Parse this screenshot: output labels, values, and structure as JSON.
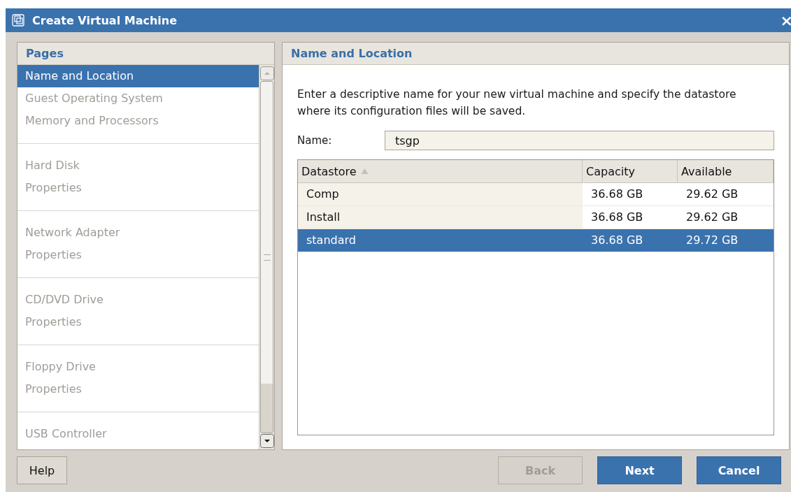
{
  "window": {
    "title": "Create Virtual Machine",
    "close": "×"
  },
  "sidebar": {
    "title": "Pages",
    "groups": [
      [
        {
          "label": "Name and Location",
          "selected": true,
          "disabled": false
        },
        {
          "label": "Guest Operating System",
          "selected": false,
          "disabled": true
        },
        {
          "label": "Memory and Processors",
          "selected": false,
          "disabled": true
        }
      ],
      [
        {
          "label": "Hard Disk",
          "selected": false,
          "disabled": true
        },
        {
          "label": "Properties",
          "selected": false,
          "disabled": true
        }
      ],
      [
        {
          "label": "Network Adapter",
          "selected": false,
          "disabled": true
        },
        {
          "label": "Properties",
          "selected": false,
          "disabled": true
        }
      ],
      [
        {
          "label": "CD/DVD Drive",
          "selected": false,
          "disabled": true
        },
        {
          "label": "Properties",
          "selected": false,
          "disabled": true
        }
      ],
      [
        {
          "label": "Floppy Drive",
          "selected": false,
          "disabled": true
        },
        {
          "label": "Properties",
          "selected": false,
          "disabled": true
        }
      ],
      [
        {
          "label": "USB Controller",
          "selected": false,
          "disabled": true
        }
      ]
    ]
  },
  "panel": {
    "title": "Name and Location",
    "description": "Enter a descriptive name for your new virtual machine and specify the datastore where its configuration files will be saved.",
    "name_label": "Name:",
    "name_value": "tsgp",
    "table": {
      "columns": [
        {
          "label": "Datastore",
          "sorted": true
        },
        {
          "label": "Capacity",
          "sorted": false
        },
        {
          "label": "Available",
          "sorted": false
        }
      ],
      "rows": [
        {
          "cells": [
            "Comp",
            "36.68 GB",
            "29.62 GB"
          ],
          "selected": false
        },
        {
          "cells": [
            "Install",
            "36.68 GB",
            "29.62 GB"
          ],
          "selected": false
        },
        {
          "cells": [
            "standard",
            "36.68 GB",
            "29.72 GB"
          ],
          "selected": true
        }
      ]
    }
  },
  "buttons": [
    {
      "label": "Help",
      "kind": "plain",
      "disabled": false
    },
    {
      "label": "Back",
      "kind": "primary",
      "disabled": true
    },
    {
      "label": "Next",
      "kind": "primary",
      "disabled": false
    },
    {
      "label": "Cancel",
      "kind": "primary",
      "disabled": false
    }
  ]
}
